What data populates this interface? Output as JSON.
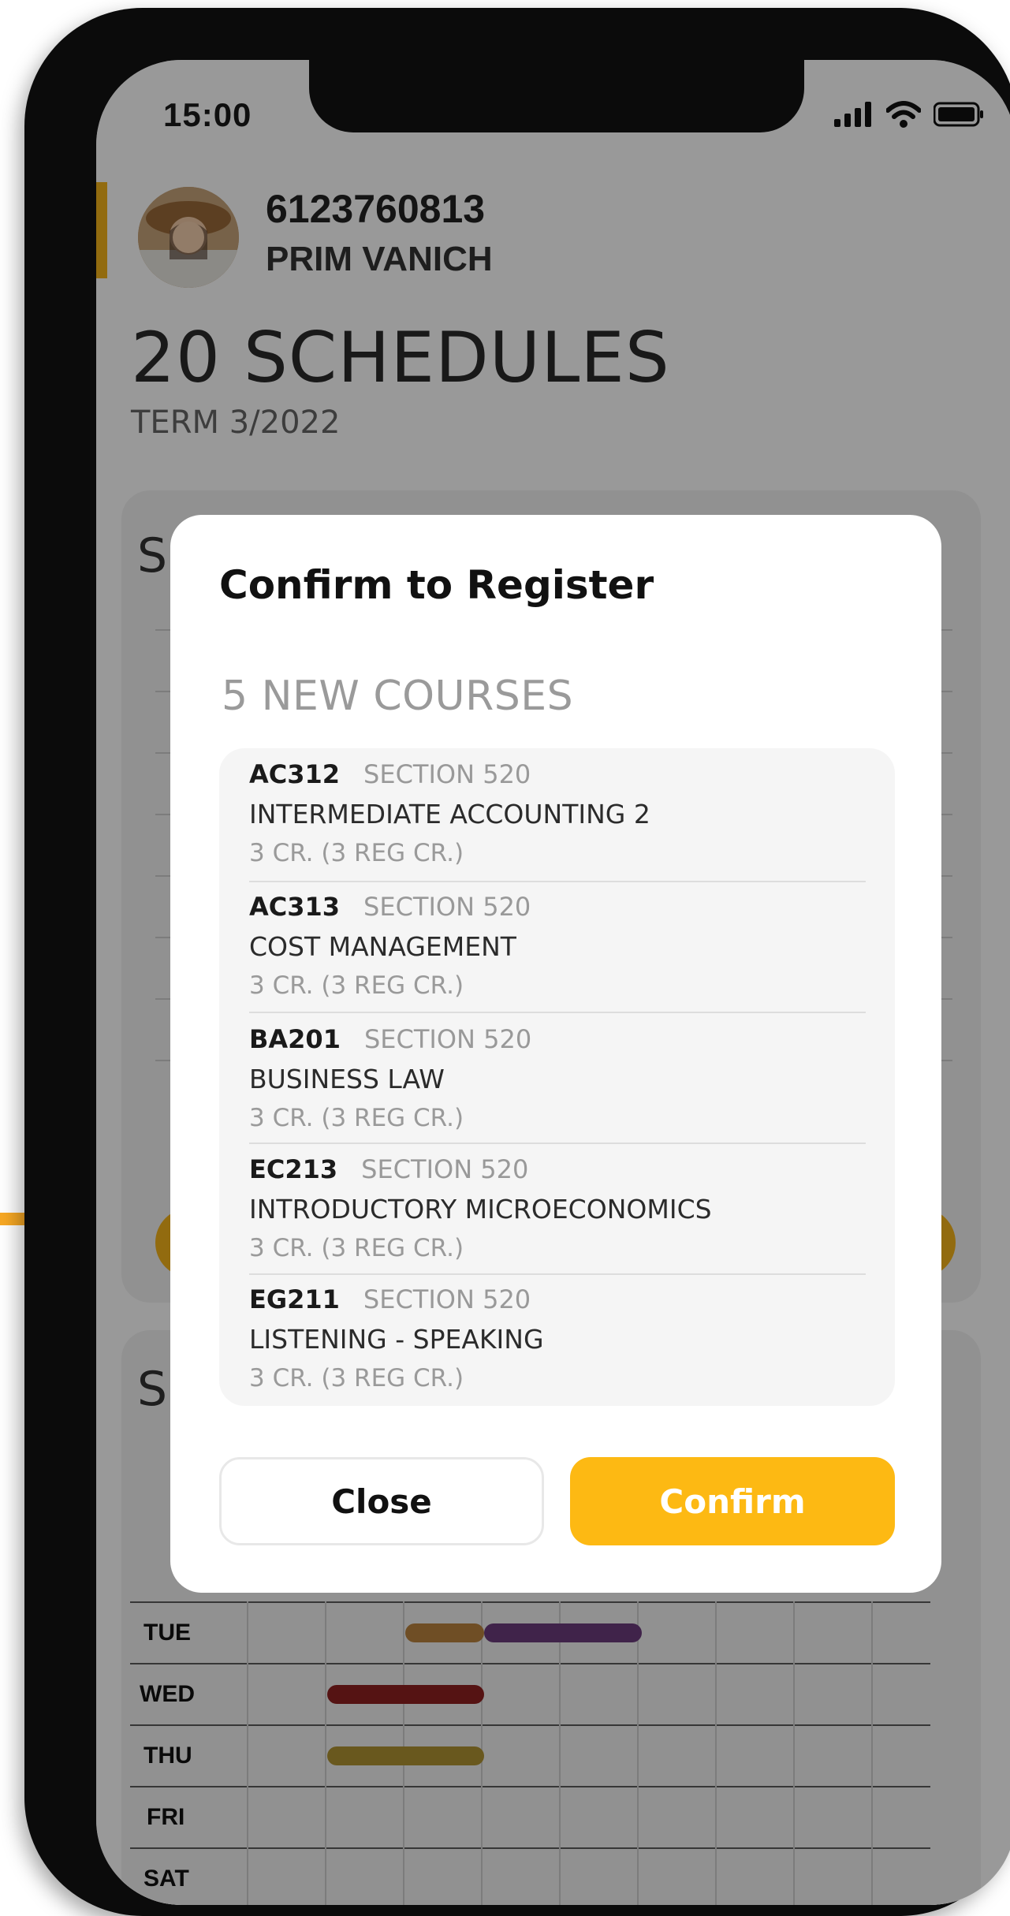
{
  "status_bar": {
    "time": "15:00"
  },
  "profile": {
    "student_id": "6123760813",
    "name": "PRIM VANICH"
  },
  "page": {
    "title": "20 SCHEDULES",
    "term": "TERM 3/2022"
  },
  "background_card_peek": [
    "S",
    "S"
  ],
  "schedule_grid": {
    "days": [
      "TUE",
      "WED",
      "THU",
      "FRI",
      "SAT"
    ],
    "colors": {
      "orange": "#b9823f",
      "purple": "#6b3b7c",
      "red": "#8e2120",
      "gold": "#b09332"
    }
  },
  "modal": {
    "title": "Confirm to Register",
    "subtitle": "5 NEW COURSES",
    "courses": [
      {
        "code": "AC312",
        "section": "SECTION 520",
        "name": "INTERMEDIATE ACCOUNTING 2",
        "credits": "3 CR. (3 REG CR.)"
      },
      {
        "code": "AC313",
        "section": "SECTION 520",
        "name": "COST MANAGEMENT",
        "credits": "3 CR. (3 REG CR.)"
      },
      {
        "code": "BA201",
        "section": "SECTION 520",
        "name": "BUSINESS LAW",
        "credits": "3 CR. (3 REG CR.)"
      },
      {
        "code": "EC213",
        "section": "SECTION 520",
        "name": "INTRODUCTORY MICROECONOMICS",
        "credits": "3 CR. (3 REG CR.)"
      },
      {
        "code": "EG211",
        "section": "SECTION 520",
        "name": "LISTENING - SPEAKING",
        "credits": "3 CR. (3 REG CR.)"
      }
    ],
    "close_label": "Close",
    "confirm_label": "Confirm"
  },
  "theme": {
    "accent": "#fdb913",
    "arrow": "#f7a824"
  }
}
